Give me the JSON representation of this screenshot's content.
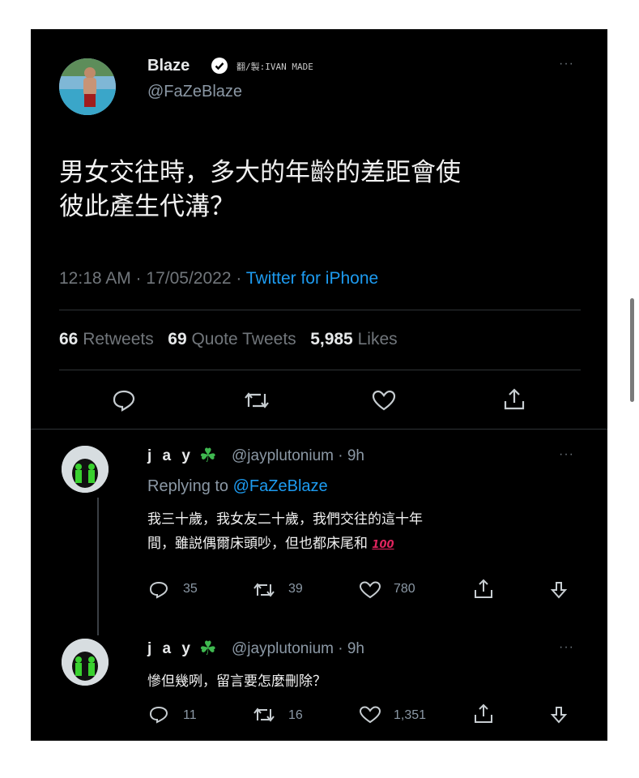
{
  "tweet": {
    "author_name": "Blaze",
    "author_handle": "@FaZeBlaze",
    "watermark": "翻/製:IVAN MADE",
    "text_line1": "男女交往時，多大的年齡的差距會使",
    "text_line2": "彼此產生代溝？",
    "time": "12:18 AM · 17/05/2022 · ",
    "source": "Twitter for iPhone",
    "retweets_count": "66",
    "retweets_label": "Retweets",
    "quotes_count": "69",
    "quotes_label": "Quote Tweets",
    "likes_count": "5,985",
    "likes_label": "Likes",
    "more": "···"
  },
  "replies": [
    {
      "name": "j a y",
      "emoji": "☘",
      "handle_time": "@jayplutonium · 9h",
      "replying_prefix": "Replying to ",
      "replying_to": "@FaZeBlaze",
      "text_line1": "我三十歲，我女友二十歲，我們交往的這十年",
      "text_line2": "間，雖説偶爾床頭吵，但也都床尾和",
      "hundred": "100",
      "reply_count": "35",
      "retweet_count": "39",
      "like_count": "780",
      "more": "···"
    },
    {
      "name": "j a y",
      "emoji": "☘",
      "handle_time": "@jayplutonium · 9h",
      "text_line1": "慘但幾咧，留言要怎麼刪除？",
      "reply_count": "11",
      "retweet_count": "16",
      "like_count": "1,351",
      "more": "···"
    }
  ],
  "colors": {
    "background": "#000000",
    "link": "#1d9bf0",
    "muted": "#71767b",
    "verified_badge": "#ffffff",
    "clover": "#3fb950"
  },
  "icons": [
    "verified-badge-icon",
    "reply-icon",
    "retweet-icon",
    "like-icon",
    "share-icon",
    "downvote-icon",
    "clover-icon",
    "more-icon"
  ]
}
